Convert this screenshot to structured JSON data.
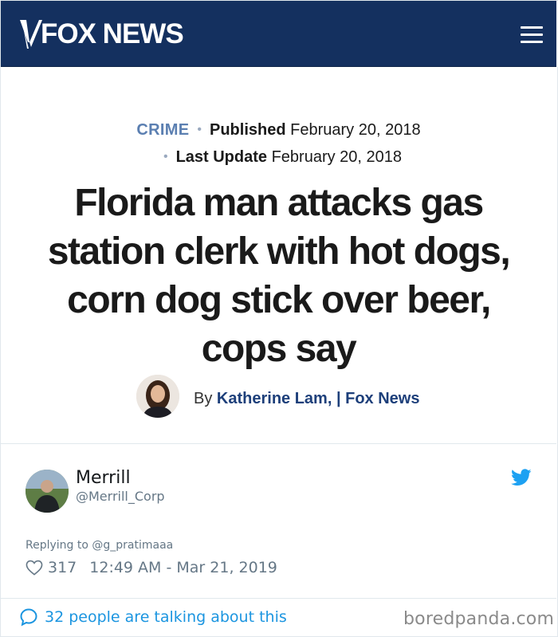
{
  "header": {
    "logo_text": "FOX NEWS",
    "menu_icon": "hamburger-menu-icon",
    "background_color": "#14305f"
  },
  "article": {
    "category": "CRIME",
    "published_label": "Published",
    "published_date": "February 20, 2018",
    "updated_label": "Last Update",
    "updated_date": "February 20, 2018",
    "headline": "Florida man attacks gas station clerk with hot dogs, corn dog stick over beer, cops say",
    "byline_prefix": "By",
    "author": "Katherine Lam,",
    "outlet": "| Fox News",
    "category_color": "#5b7fb1",
    "author_color": "#1d3f7a"
  },
  "tweet": {
    "name": "Merrill",
    "handle": "@Merrill_Corp",
    "replying_to": "Replying to @g_pratimaaa",
    "likes": "317",
    "timestamp": "12:49 AM - Mar 21, 2019",
    "talking": "32 people are talking about this",
    "accent_color": "#1b95e0",
    "bird_icon": "twitter-bird-icon"
  },
  "watermark": "boredpanda.com"
}
